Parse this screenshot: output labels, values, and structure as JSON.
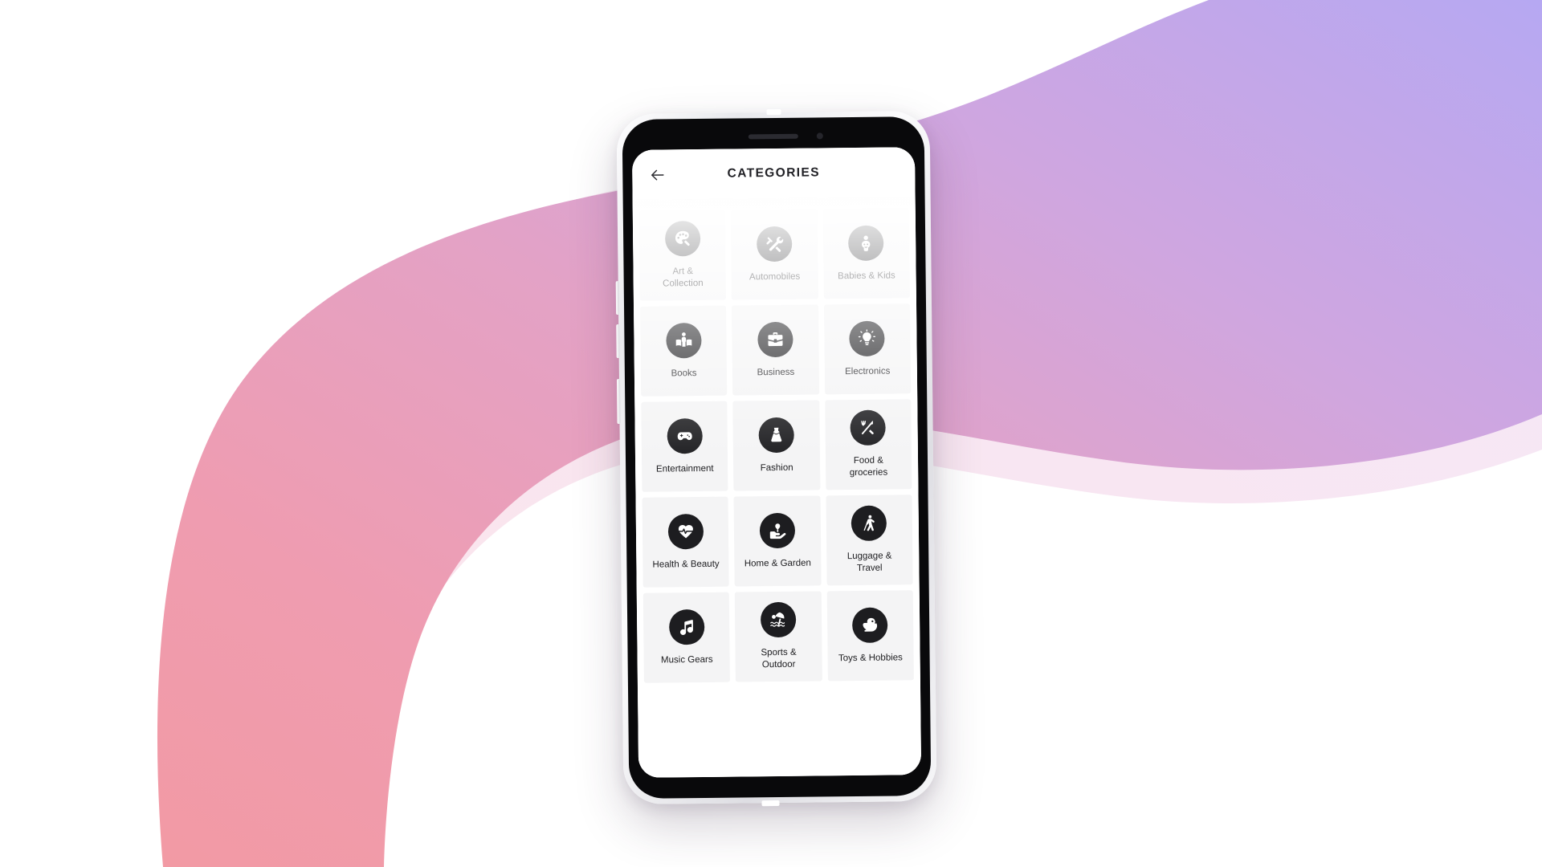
{
  "background": {
    "page_color": "#ffffff",
    "blob_gradient_from": "#f2919f",
    "blob_gradient_mid": "#d9a0cd",
    "blob_gradient_to": "#b9a6ef",
    "blob_shadow_color": "#f7dce6"
  },
  "device": {
    "frame_color": "#eaeaef",
    "bezel_color": "#09090b",
    "screen_color": "#ffffff"
  },
  "app": {
    "appbar": {
      "title": "CATEGORIES",
      "back_icon": "arrow-left-icon",
      "background": "#ffffff",
      "title_color": "#1f1f24"
    },
    "grid": {
      "columns": 3,
      "icon_bg": "#1d1d20",
      "card_bg": "#f4f4f5",
      "items": [
        {
          "label": "Art &\nCollection",
          "label_line1": "Art &",
          "label_line2": "Collection",
          "icon": "palette-icon"
        },
        {
          "label": "Automobiles",
          "label_line1": "Automobiles",
          "label_line2": "",
          "icon": "tools-icon"
        },
        {
          "label": "Babies & Kids",
          "label_line1": "Babies & Kids",
          "label_line2": "",
          "icon": "baby-icon"
        },
        {
          "label": "Books",
          "label_line1": "Books",
          "label_line2": "",
          "icon": "book-reader-icon"
        },
        {
          "label": "Business",
          "label_line1": "Business",
          "label_line2": "",
          "icon": "briefcase-icon"
        },
        {
          "label": "Electronics",
          "label_line1": "Electronics",
          "label_line2": "",
          "icon": "lightbulb-icon"
        },
        {
          "label": "Entertainment",
          "label_line1": "Entertainment",
          "label_line2": "",
          "icon": "gamepad-icon"
        },
        {
          "label": "Fashion",
          "label_line1": "Fashion",
          "label_line2": "",
          "icon": "dress-icon"
        },
        {
          "label": "Food &\ngroceries",
          "label_line1": "Food &",
          "label_line2": "groceries",
          "icon": "fork-knife-icon"
        },
        {
          "label": "Health & Beauty",
          "label_line1": "Health & Beauty",
          "label_line2": "",
          "icon": "heart-pulse-icon"
        },
        {
          "label": "Home & Garden",
          "label_line1": "Home & Garden",
          "label_line2": "",
          "icon": "hand-plant-icon"
        },
        {
          "label": "Luggage &\nTravel",
          "label_line1": "Luggage &",
          "label_line2": "Travel",
          "icon": "walking-person-icon"
        },
        {
          "label": "Music Gears",
          "label_line1": "Music Gears",
          "label_line2": "",
          "icon": "music-note-icon"
        },
        {
          "label": "Sports &\nOutdoor",
          "label_line1": "Sports &",
          "label_line2": "Outdoor",
          "icon": "beach-umbrella-icon"
        },
        {
          "label": "Toys & Hobbies",
          "label_line1": "Toys & Hobbies",
          "label_line2": "",
          "icon": "rubber-duck-icon"
        }
      ]
    }
  }
}
